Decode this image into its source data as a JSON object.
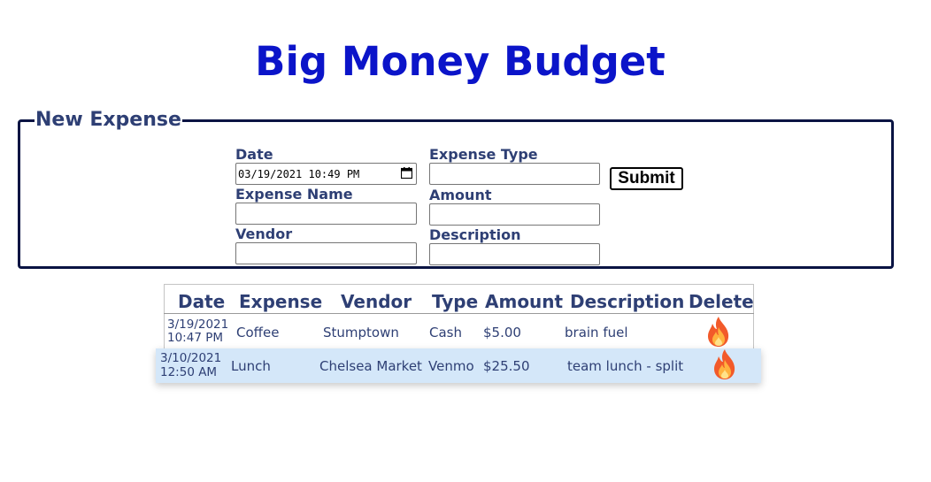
{
  "app": {
    "title": "Big Money Budget"
  },
  "form": {
    "legend": "New Expense",
    "fields": {
      "date": {
        "label": "Date",
        "value": "03/19/2021 10:49 PM"
      },
      "expense_type": {
        "label": "Expense Type",
        "value": ""
      },
      "expense_name": {
        "label": "Expense Name",
        "value": ""
      },
      "amount": {
        "label": "Amount",
        "value": ""
      },
      "vendor": {
        "label": "Vendor",
        "value": ""
      },
      "description": {
        "label": "Description",
        "value": ""
      }
    },
    "submit_label": "Submit"
  },
  "table": {
    "headers": [
      "Date",
      "Expense",
      "Vendor",
      "Type",
      "Amount",
      "Description",
      "Delete"
    ],
    "rows": [
      {
        "date_line1": "3/19/2021",
        "date_line2": "10:47 PM",
        "expense": "Coffee",
        "vendor": "Stumptown",
        "type": "Cash",
        "amount": "$5.00",
        "description": "brain fuel",
        "delete_icon": "fire-icon"
      },
      {
        "date_line1": "3/10/2021",
        "date_line2": "12:50 AM",
        "expense": "Lunch",
        "vendor": "Chelsea Market",
        "type": "Venmo",
        "amount": "$25.50",
        "description": "team lunch - split",
        "delete_icon": "fire-icon"
      }
    ],
    "hovered_row_color": "#d4e7f9"
  },
  "colors": {
    "title": "#0b14c9",
    "label": "#2e3f74",
    "border": "#0a1443"
  }
}
